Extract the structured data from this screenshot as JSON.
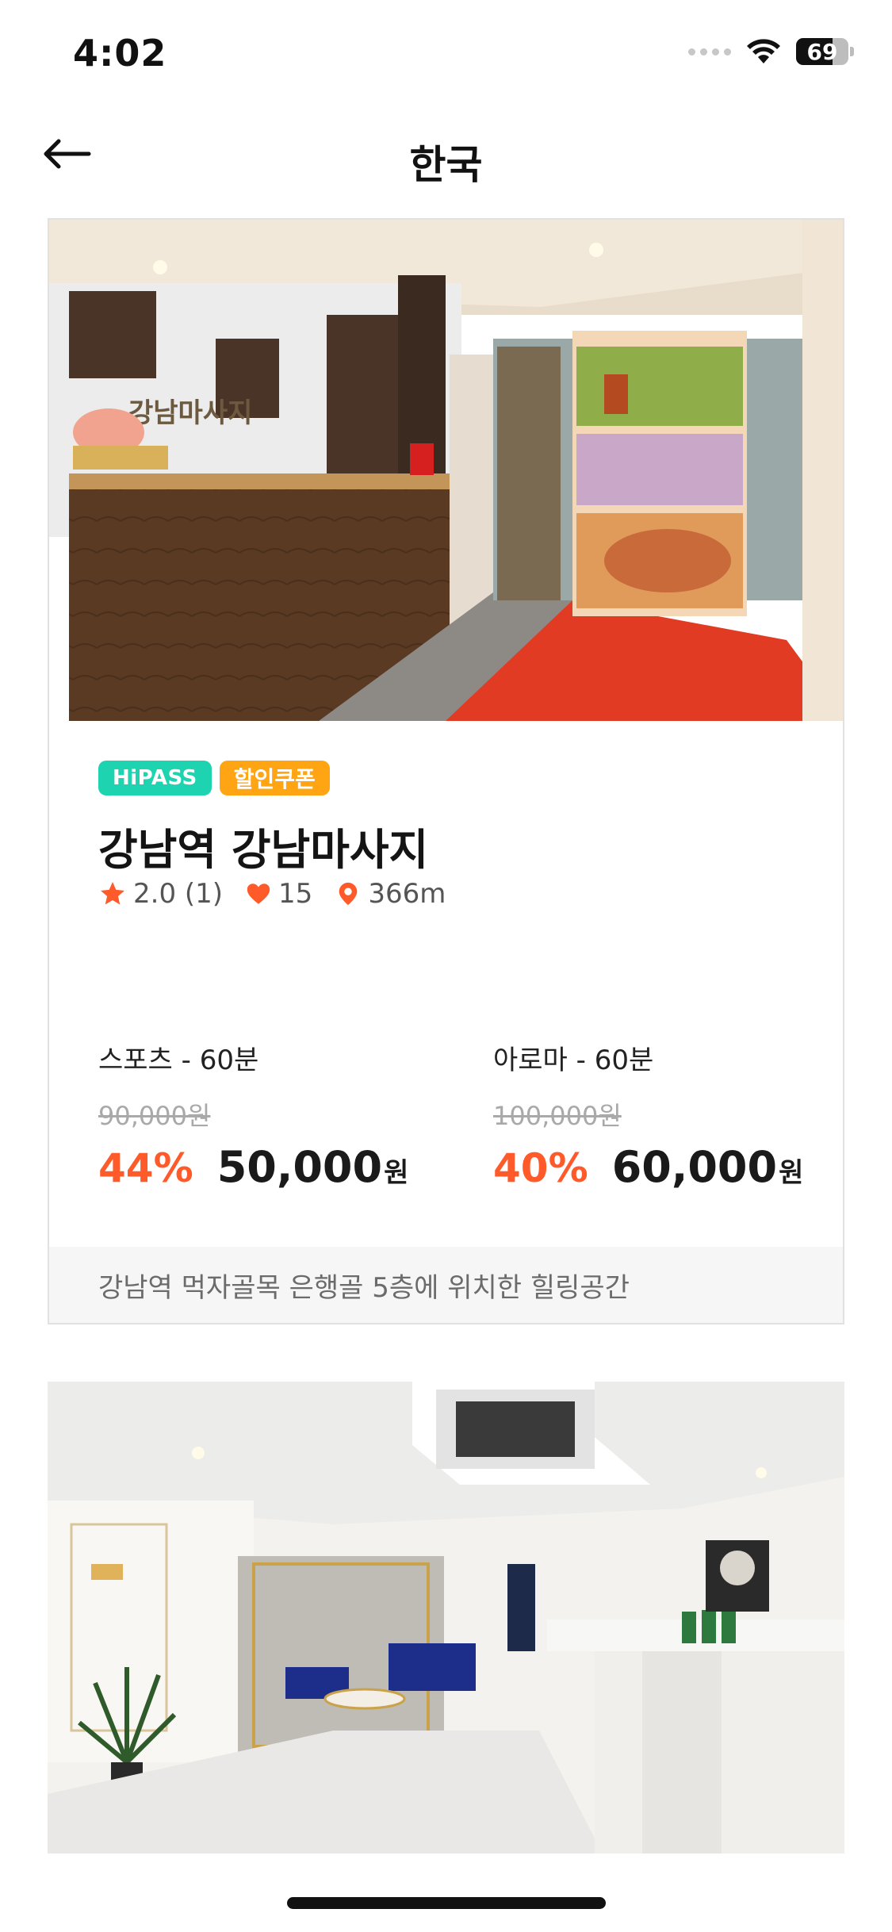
{
  "status_bar": {
    "time": "4:02",
    "battery": "69",
    "battery_level": 0.69
  },
  "nav": {
    "title": "한국",
    "back_icon": "arrow-left-icon"
  },
  "listing": {
    "badges": {
      "hipass": "HiPASS",
      "coupon": "할인쿠폰"
    },
    "name": "강남역 강남마사지",
    "rating": "2.0 (1)",
    "likes": "15",
    "distance": "366m",
    "prices": [
      {
        "title": "스포츠 - 60분",
        "original": "90,000원",
        "discount": "44%",
        "price": "50,000",
        "unit": "원"
      },
      {
        "title": "아로마 - 60분",
        "original": "100,000원",
        "discount": "40%",
        "price": "60,000",
        "unit": "원"
      }
    ],
    "description": "강남역 먹자골목 은행골 5층에 위치한 힐링공간",
    "photo_sign": "강남마사지"
  },
  "colors": {
    "accent": "#ff5a2a",
    "hipass": "#1dd3b0",
    "coupon": "#ffa412"
  }
}
